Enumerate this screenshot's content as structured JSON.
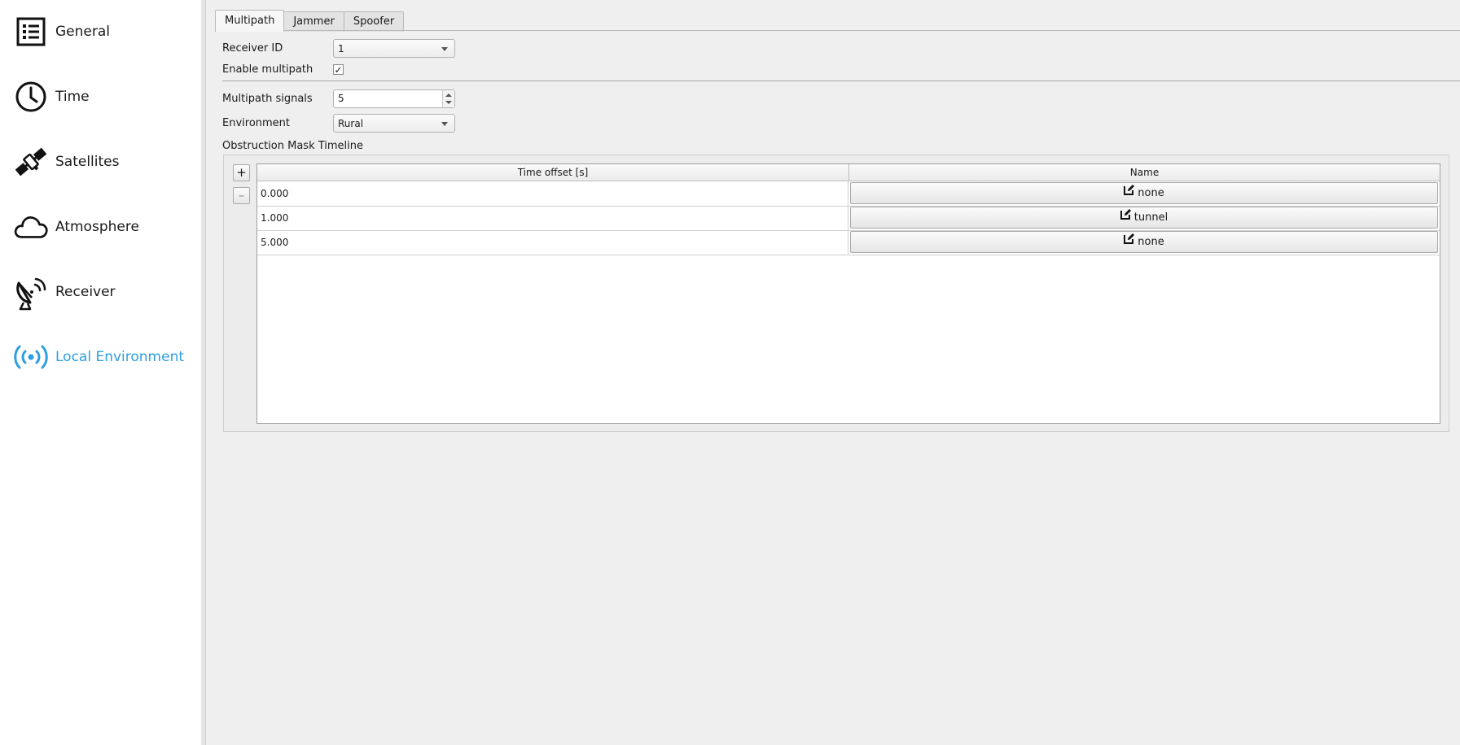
{
  "sidebar": {
    "items": [
      {
        "label": "General",
        "icon": "list-icon",
        "active": false
      },
      {
        "label": "Time",
        "icon": "clock-icon",
        "active": false
      },
      {
        "label": "Satellites",
        "icon": "satellite-icon",
        "active": false
      },
      {
        "label": "Atmosphere",
        "icon": "cloud-icon",
        "active": false
      },
      {
        "label": "Receiver",
        "icon": "satellite-dish-icon",
        "active": false
      },
      {
        "label": "Local Environment",
        "icon": "broadcast-icon",
        "active": true
      }
    ],
    "active_color": "#2d9ee0"
  },
  "tabs": [
    {
      "label": "Multipath",
      "active": true
    },
    {
      "label": "Jammer",
      "active": false
    },
    {
      "label": "Spoofer",
      "active": false
    }
  ],
  "form": {
    "receiver_id_label": "Receiver ID",
    "receiver_id_value": "1",
    "enable_multipath_label": "Enable multipath",
    "enable_multipath_checked": true,
    "enable_multipath_mark": "✓",
    "multipath_signals_label": "Multipath signals",
    "multipath_signals_value": "5",
    "environment_label": "Environment",
    "environment_value": "Rural"
  },
  "obstruction": {
    "title": "Obstruction Mask Timeline",
    "add_button": "+",
    "remove_button": "–",
    "columns": [
      "Time offset [s]",
      "Name"
    ],
    "rows": [
      {
        "time": "0.000",
        "name": "none"
      },
      {
        "time": "1.000",
        "name": "tunnel"
      },
      {
        "time": "5.000",
        "name": "none"
      }
    ]
  }
}
